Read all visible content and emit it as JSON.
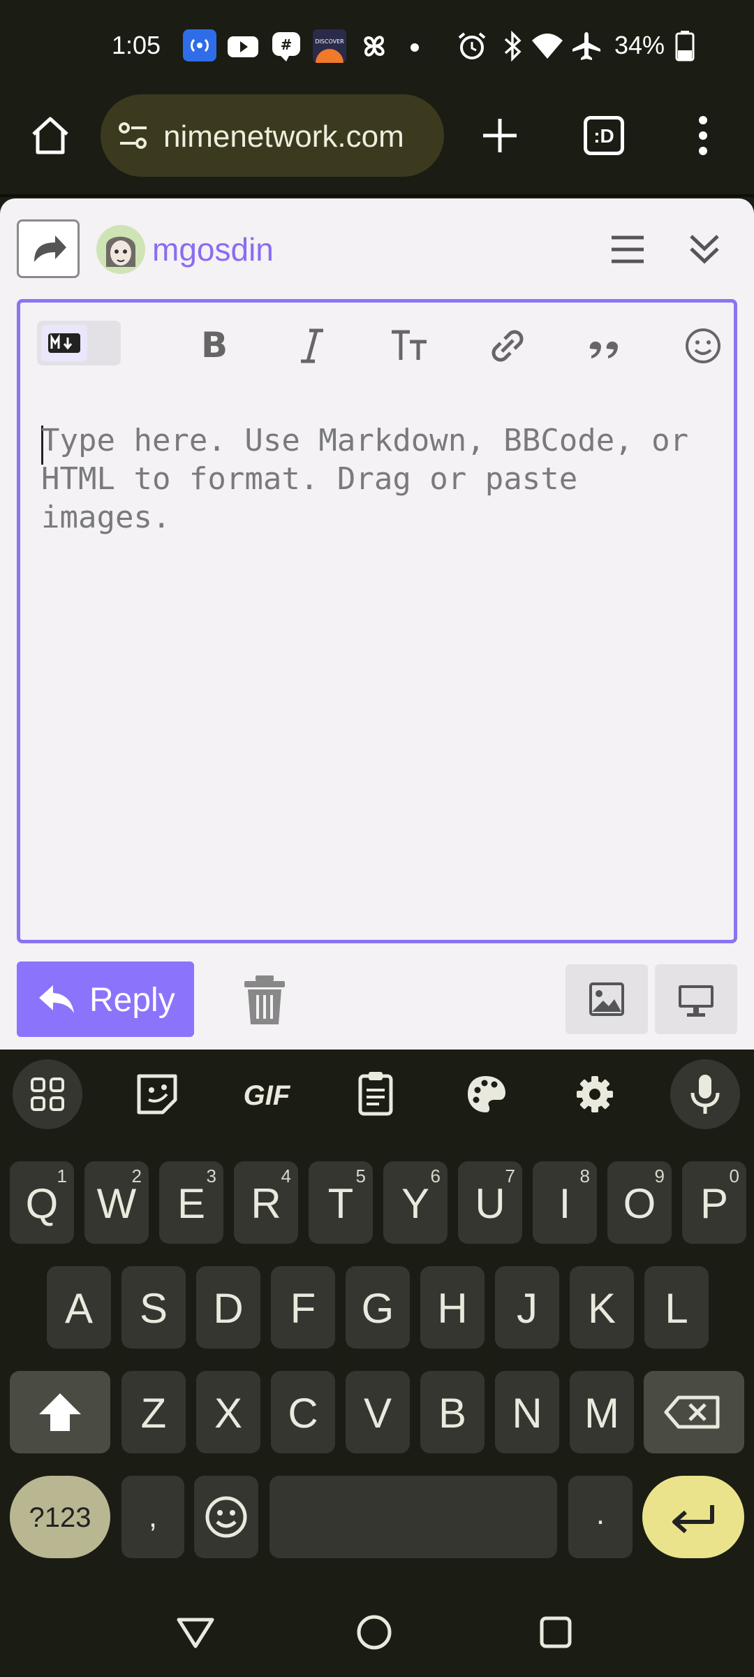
{
  "status_bar": {
    "time": "1:05",
    "battery": "34%",
    "icons": [
      "radio-icon",
      "youtube-icon",
      "chat-icon",
      "discover-icon",
      "pinwheel-icon",
      "dot-icon",
      "alarm-icon",
      "bluetooth-icon",
      "wifi-icon",
      "airplane-icon",
      "battery-icon"
    ]
  },
  "browser": {
    "url": "nimenetwork.com",
    "tab_label": ":D"
  },
  "post": {
    "username": "mgosdin",
    "composer_placeholder": "Type here. Use Markdown, BBCode, or HTML to format. Drag or paste images.",
    "formatting_tools": [
      "markdown-toggle",
      "bold",
      "italic",
      "heading",
      "link",
      "quote",
      "emoji"
    ],
    "reply_label": "Reply"
  },
  "keyboard": {
    "toolbar": [
      "apps",
      "sticker",
      "GIF",
      "clipboard",
      "palette",
      "settings",
      "microphone"
    ],
    "row1": [
      {
        "key": "Q",
        "hint": "1"
      },
      {
        "key": "W",
        "hint": "2"
      },
      {
        "key": "E",
        "hint": "3"
      },
      {
        "key": "R",
        "hint": "4"
      },
      {
        "key": "T",
        "hint": "5"
      },
      {
        "key": "Y",
        "hint": "6"
      },
      {
        "key": "U",
        "hint": "7"
      },
      {
        "key": "I",
        "hint": "8"
      },
      {
        "key": "O",
        "hint": "9"
      },
      {
        "key": "P",
        "hint": "0"
      }
    ],
    "row2": [
      "A",
      "S",
      "D",
      "F",
      "G",
      "H",
      "J",
      "K",
      "L"
    ],
    "row3": [
      "Z",
      "X",
      "C",
      "V",
      "B",
      "N",
      "M"
    ],
    "symbols_label": "?123",
    "comma": ",",
    "period": ".",
    "gif_label": "GIF"
  },
  "colors": {
    "accent": "#8c73fc",
    "enter_key": "#ebe38c",
    "symbols_key": "#b9b792"
  }
}
